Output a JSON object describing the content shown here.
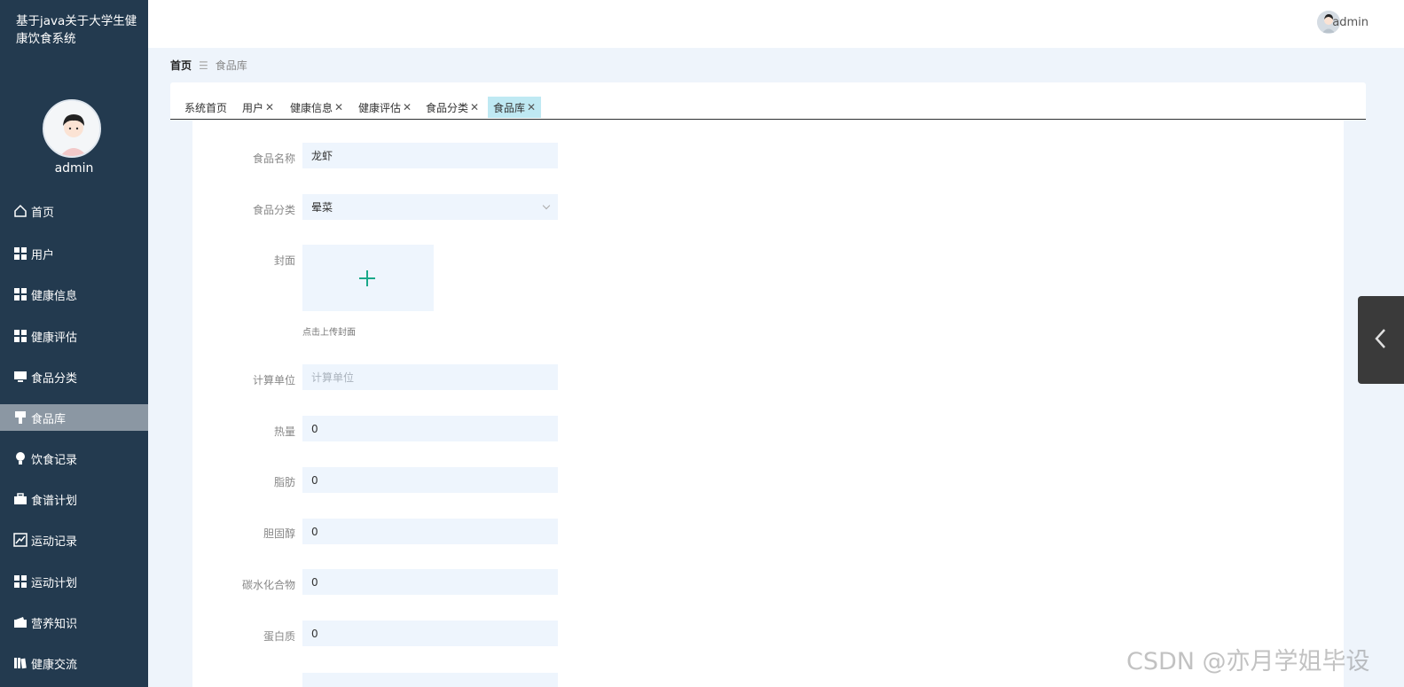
{
  "app": {
    "title": "基于java关于大学生健康饮食系统"
  },
  "sidebar": {
    "user_name": "admin",
    "items": [
      {
        "label": "首页",
        "icon": "home-icon"
      },
      {
        "label": "用户",
        "icon": "grid-icon"
      },
      {
        "label": "健康信息",
        "icon": "grid-icon"
      },
      {
        "label": "健康评估",
        "icon": "grid-icon"
      },
      {
        "label": "食品分类",
        "icon": "monitor-icon"
      },
      {
        "label": "食品库",
        "icon": "brush-icon",
        "active": true
      },
      {
        "label": "饮食记录",
        "icon": "bulb-icon"
      },
      {
        "label": "食谱计划",
        "icon": "briefcase-icon"
      },
      {
        "label": "运动记录",
        "icon": "chart-icon"
      },
      {
        "label": "运动计划",
        "icon": "grid-icon"
      },
      {
        "label": "营养知识",
        "icon": "wallet-icon"
      },
      {
        "label": "健康交流",
        "icon": "book-icon"
      }
    ]
  },
  "header": {
    "user_name": "admin"
  },
  "breadcrumb": {
    "home": "首页",
    "current": "食品库"
  },
  "tabs": [
    {
      "label": "系统首页",
      "closable": false
    },
    {
      "label": "用户",
      "closable": true
    },
    {
      "label": "健康信息",
      "closable": true
    },
    {
      "label": "健康评估",
      "closable": true
    },
    {
      "label": "食品分类",
      "closable": true
    },
    {
      "label": "食品库",
      "closable": true,
      "active": true
    }
  ],
  "tab_close_glyph": "✕",
  "form": {
    "name": {
      "label": "食品名称",
      "value": "龙虾"
    },
    "category": {
      "label": "食品分类",
      "value": "晕菜"
    },
    "cover": {
      "label": "封面",
      "hint": "点击上传封面"
    },
    "unit": {
      "label": "计算单位",
      "placeholder": "计算单位"
    },
    "calories": {
      "label": "热量",
      "value": "0"
    },
    "fat": {
      "label": "脂肪",
      "value": "0"
    },
    "cholesterol": {
      "label": "胆固醇",
      "value": "0"
    },
    "carbohydrate": {
      "label": "碳水化合物",
      "value": "0"
    },
    "protein": {
      "label": "蛋白质",
      "value": "0"
    }
  },
  "watermark": "CSDN @亦月学姐毕设",
  "colors": {
    "sidebar_bg": "#233a4f",
    "active_menu": "#8b97a3",
    "active_tab": "#bfe9f3",
    "input_bg": "#eef5fd",
    "plus_accent": "#1aa88a"
  }
}
